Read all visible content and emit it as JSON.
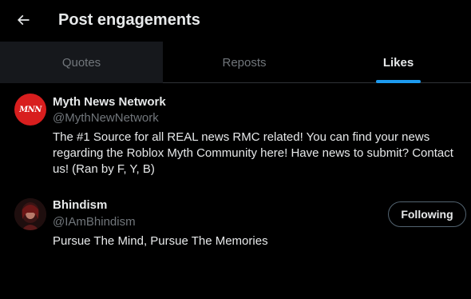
{
  "header": {
    "title": "Post engagements",
    "back_icon": "arrow-left-icon"
  },
  "tabs": [
    {
      "label": "Quotes",
      "active": false
    },
    {
      "label": "Reposts",
      "active": false
    },
    {
      "label": "Likes",
      "active": true
    }
  ],
  "users": [
    {
      "name": "Myth News Network",
      "handle": "@MythNewNetwork",
      "avatar_text": "MNN",
      "bio": "The #1 Source for all REAL news RMC related! You can find your news regarding the Roblox Myth Community here! Have news to submit? Contact us! (Ran by F, Y, B)"
    },
    {
      "name": "Bhindism",
      "handle": "@IAmBhindism",
      "bio": "Pursue The Mind, Pursue The Memories",
      "follow_label": "Following"
    }
  ],
  "colors": {
    "accent": "#1d9bf0",
    "background": "#000000",
    "text_primary": "#e7e9ea",
    "text_secondary": "#71767b"
  }
}
